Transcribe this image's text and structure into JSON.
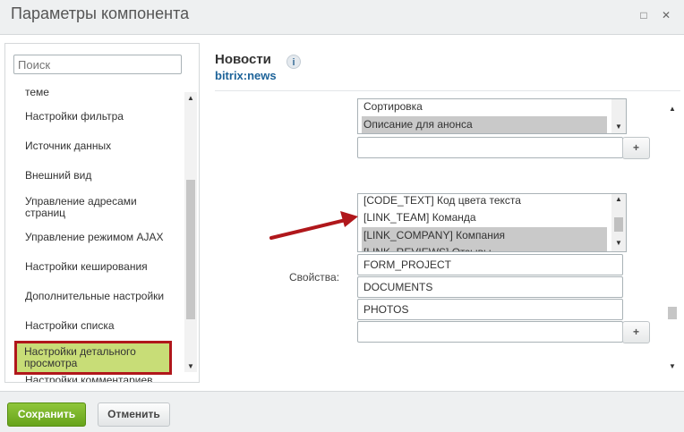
{
  "window": {
    "title": "Параметры компонента",
    "maximize_symbol": "□",
    "close_symbol": "✕"
  },
  "sidebar": {
    "search_placeholder": "Поиск",
    "items": [
      {
        "label": "теме"
      },
      {
        "label": "Настройки фильтра"
      },
      {
        "label": "Источник данных"
      },
      {
        "label": "Внешний вид"
      },
      {
        "label": "Управление адресами страниц"
      },
      {
        "label": "Управление режимом AJAX"
      },
      {
        "label": "Настройки кеширования"
      },
      {
        "label": "Дополнительные настройки"
      },
      {
        "label": "Настройки списка"
      },
      {
        "label": "Настройки детального просмотра"
      },
      {
        "label": "Настройки комментариев"
      }
    ],
    "active_index": 9,
    "highlight_color": "#c8dd77",
    "highlight_border_color": "#b0171b"
  },
  "component": {
    "title": "Новости",
    "code": "bitrix:news",
    "info_symbol": "i"
  },
  "fields_list": {
    "options": [
      {
        "label": "Сортировка",
        "selected": false
      },
      {
        "label": "Описание для анонса",
        "selected": true
      }
    ],
    "empty_input": "",
    "add_label": "+"
  },
  "properties_list": {
    "options": [
      {
        "label": "[CODE_TEXT] Код цвета текста",
        "selected": false
      },
      {
        "label": "[LINK_TEAM] Команда",
        "selected": false
      },
      {
        "label": "[LINK_COMPANY] Компания",
        "selected": true
      },
      {
        "label": "[LINK_REVIEWS] Отзывы",
        "selected": true
      }
    ]
  },
  "properties": {
    "label": "Свойства:",
    "values": [
      "FORM_PROJECT",
      "DOCUMENTS",
      "PHOTOS"
    ],
    "empty_input": "",
    "add_label": "+"
  },
  "annotation": {
    "arrow_color": "#b0171b"
  },
  "footer": {
    "save_label": "Сохранить",
    "cancel_label": "Отменить",
    "save_color": "#7ab52c"
  }
}
